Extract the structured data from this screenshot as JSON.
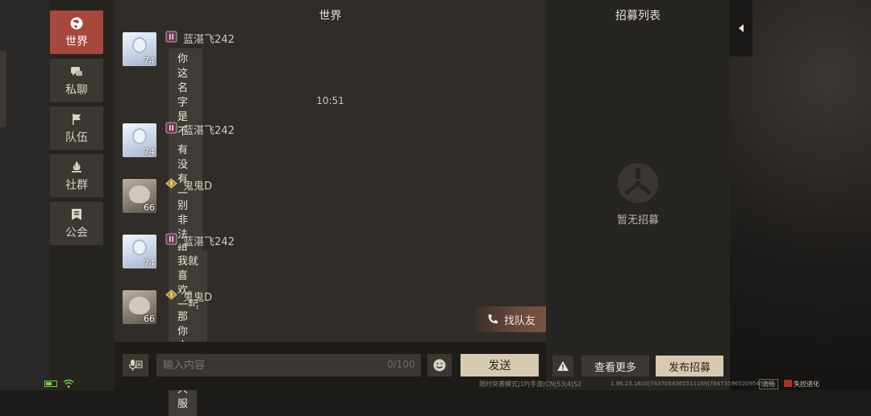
{
  "sidebar": {
    "items": [
      {
        "label": "世界",
        "icon": "globe-icon",
        "active": true
      },
      {
        "label": "私聊",
        "icon": "chat-bubbles-icon",
        "active": false
      },
      {
        "label": "队伍",
        "icon": "flag-icon",
        "active": false
      },
      {
        "label": "社群",
        "icon": "campfire-icon",
        "active": false
      },
      {
        "label": "公会",
        "icon": "guild-banner-icon",
        "active": false
      }
    ]
  },
  "chat": {
    "title": "世界",
    "timestamp": "10:51",
    "messages": [
      {
        "user": "蓝湛飞242",
        "level": "74",
        "avatar": "anime-girl",
        "text": "你这名字是不是拿把汤姆逊追着\n一个人?"
      },
      {
        "user": "蓝湛飞242",
        "level": "74",
        "avatar": "anime-girl",
        "text": "有没有一起去火发?"
      },
      {
        "user": "鬼鬼D",
        "level": "66",
        "avatar": "cat",
        "text": "别非法组队了行不"
      },
      {
        "user": "蓝湛飞242",
        "level": "74",
        "avatar": "anime-girl",
        "text": "我就喜欢。一起收集。"
      },
      {
        "user": "鬼鬼D",
        "level": "66",
        "avatar": "cat",
        "text": "那你去玩双人服"
      }
    ],
    "find_team_label": "找队友"
  },
  "input": {
    "placeholder": "输入内容",
    "counter": "0/100",
    "send_label": "发送"
  },
  "recruit": {
    "title": "招募列表",
    "empty_text": "暂无招募",
    "more_label": "查看更多",
    "publish_label": "发布招募"
  },
  "statusbar": {
    "mode_text": "限时突袭模式|1P|手游|CN|53|4|S2",
    "version_text": "1.96.23.1610|7437058361511169|7847359652095457",
    "network_label": "流畅",
    "brand_label": "失控进化"
  },
  "colors": {
    "active_tab": "#a8473c",
    "primary_button": "#d8c9b1",
    "panel_bg": "#302d29",
    "battery_green": "#7ad04a"
  }
}
